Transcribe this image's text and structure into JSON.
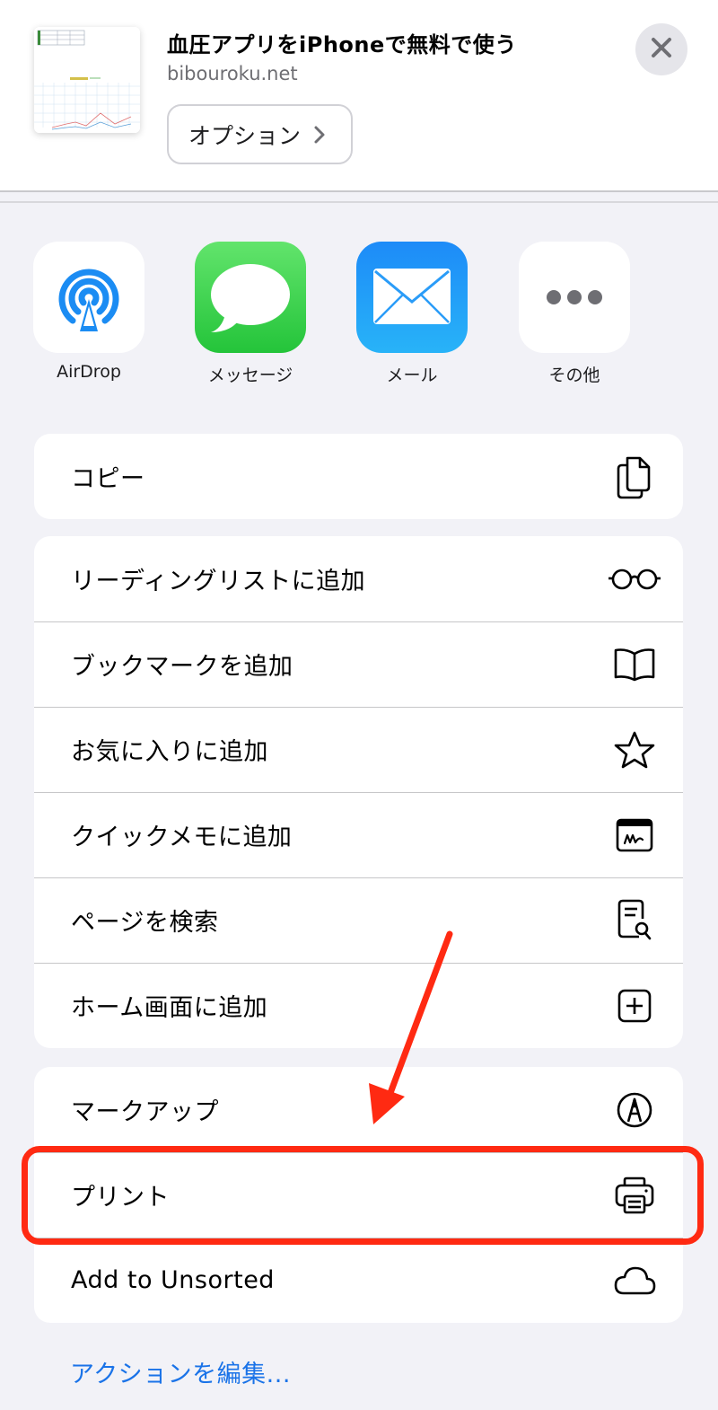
{
  "header": {
    "title": "血圧アプリをiPhoneで無料で使う",
    "domain": "bibouroku.net",
    "options_label": "オプション"
  },
  "share_apps": [
    {
      "label": "AirDrop",
      "icon": "airdrop-icon"
    },
    {
      "label": "メッセージ",
      "icon": "messages-icon"
    },
    {
      "label": "メール",
      "icon": "mail-icon"
    },
    {
      "label": "その他",
      "icon": "more-icon"
    }
  ],
  "groups": [
    {
      "items": [
        {
          "label": "コピー",
          "icon": "copy-icon"
        }
      ]
    },
    {
      "items": [
        {
          "label": "リーディングリストに追加",
          "icon": "glasses-icon"
        },
        {
          "label": "ブックマークを追加",
          "icon": "book-icon"
        },
        {
          "label": "お気に入りに追加",
          "icon": "star-icon"
        },
        {
          "label": "クイックメモに追加",
          "icon": "quick-note-icon"
        },
        {
          "label": "ページを検索",
          "icon": "find-on-page-icon"
        },
        {
          "label": "ホーム画面に追加",
          "icon": "add-square-icon"
        }
      ]
    },
    {
      "items": [
        {
          "label": "マークアップ",
          "icon": "markup-icon"
        },
        {
          "label": "プリント",
          "icon": "printer-icon"
        },
        {
          "label": "Add to Unsorted",
          "icon": "cloud-icon"
        }
      ]
    }
  ],
  "edit_actions_label": "アクションを編集...",
  "colors": {
    "highlight": "#ff2a12",
    "link": "#1a73e8"
  }
}
